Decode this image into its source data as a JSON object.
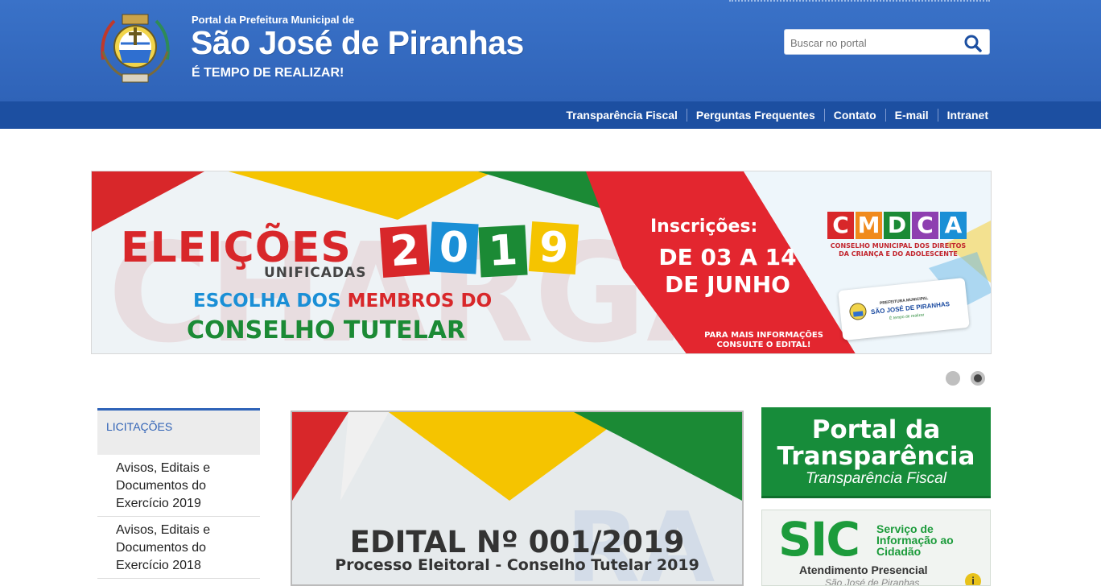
{
  "header": {
    "subtitle": "Portal da Prefeitura Municipal de",
    "title": "São José de Piranhas",
    "slogan": "É TEMPO DE REALIZAR!",
    "logo_icon": "city-coat-of-arms-icon"
  },
  "search": {
    "placeholder": "Buscar no portal",
    "icon": "search-icon"
  },
  "nav": {
    "links": [
      "Transparência Fiscal",
      "Perguntas Frequentes",
      "Contato",
      "E-mail",
      "Intranet"
    ]
  },
  "banner": {
    "line1": "ELEIÇÕES",
    "year_digits": [
      "2",
      "0",
      "1",
      "9"
    ],
    "unificadas": "UNIFICADAS",
    "escolha_a": "ESCOLHA DOS ",
    "escolha_b": "MEMBROS DO",
    "conselho": "CONSELHO TUTELAR",
    "inscricoes": "Inscrições:",
    "dates_line1": "DE 03 A 14",
    "dates_line2": "DE JUNHO",
    "info": "PARA MAIS INFORMAÇÕES CONSULTE O EDITAL!",
    "cmdca_letters": [
      "C",
      "M",
      "D",
      "C",
      "A"
    ],
    "cmdca_sub": "CONSELHO MUNICIPAL DOS DIREITOS DA CRIANÇA E DO ADOLESCENTE",
    "card_line1": "PREFEITURA MUNICIPAL",
    "card_line2": "SÃO JOSÉ DE PIRANHAS",
    "card_line3": "É tempo de realizar",
    "slide_count": 2,
    "active_slide": 2
  },
  "sidebar": {
    "heading": "LICITAÇÕES",
    "items": [
      {
        "label": "Avisos, Editais e Documentos do Exercício 2019"
      },
      {
        "label": "Avisos, Editais e Documentos do Exercício 2018"
      }
    ]
  },
  "news": {
    "title": "EDITAL Nº 001/2019",
    "subtitle": "Processo Eleitoral - Conselho Tutelar 2019"
  },
  "transparencia": {
    "title_line1": "Portal da",
    "title_line2": "Transparência",
    "subtitle": "Transparência Fiscal"
  },
  "sic": {
    "acronym": "SIC",
    "desc_line1": "Serviço de",
    "desc_line2": "Informação ao",
    "desc_line3": "Cidadão",
    "atendimento": "Atendimento Presencial",
    "local": "São José de Piranhas",
    "info_icon": "i"
  },
  "colors": {
    "header_blue": "#2f63b8",
    "navbar_blue": "#1c4fa1",
    "green": "#178c3a",
    "red": "#d8272a",
    "yellow": "#f5c400"
  }
}
